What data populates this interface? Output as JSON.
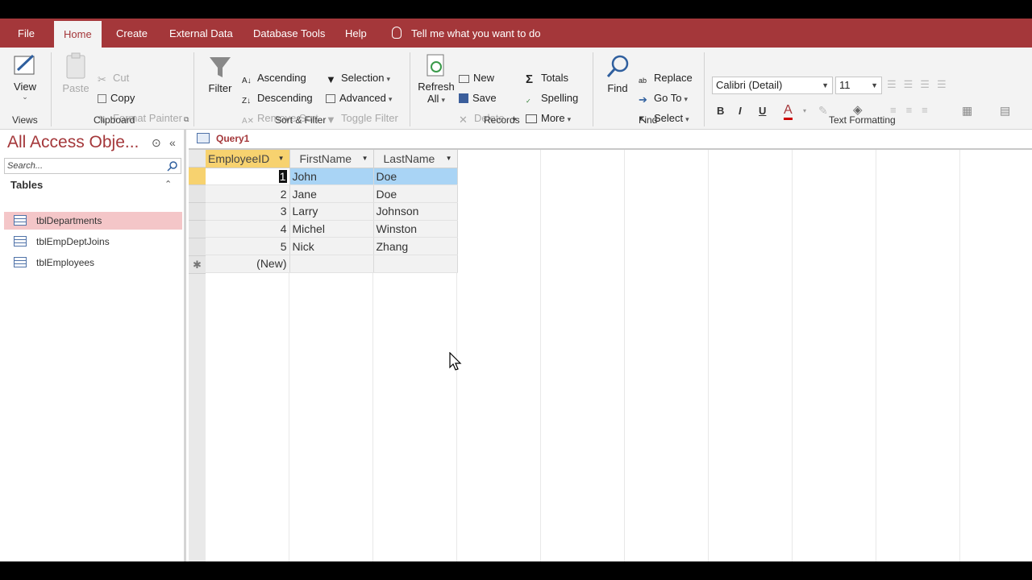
{
  "tabs": {
    "file": "File",
    "home": "Home",
    "create": "Create",
    "external": "External Data",
    "dbtools": "Database Tools",
    "help": "Help",
    "tell": "Tell me what you want to do"
  },
  "ribbon": {
    "views": {
      "view": "View",
      "label": "Views"
    },
    "clipboard": {
      "paste": "Paste",
      "cut": "Cut",
      "copy": "Copy",
      "format_painter": "Format Painter",
      "label": "Clipboard"
    },
    "sort_filter": {
      "filter": "Filter",
      "ascending": "Ascending",
      "descending": "Descending",
      "remove_sort": "Remove Sort",
      "selection": "Selection",
      "advanced": "Advanced",
      "toggle_filter": "Toggle Filter",
      "label": "Sort & Filter"
    },
    "records": {
      "refresh_1": "Refresh",
      "refresh_2": "All",
      "new": "New",
      "save": "Save",
      "delete": "Delete",
      "totals": "Totals",
      "spelling": "Spelling",
      "more": "More",
      "label": "Records"
    },
    "find": {
      "find": "Find",
      "replace": "Replace",
      "goto": "Go To",
      "select": "Select",
      "label": "Find"
    },
    "text_formatting": {
      "font": "Calibri (Detail)",
      "size": "11",
      "bold": "B",
      "italic": "I",
      "underline": "U",
      "label": "Text Formatting"
    }
  },
  "nav": {
    "title": "All Access Obje...",
    "search_placeholder": "Search...",
    "section": "Tables",
    "items": [
      "tblDepartments",
      "tblEmpDeptJoins",
      "tblEmployees"
    ]
  },
  "doc": {
    "tab": "Query1",
    "columns": [
      "EmployeeID",
      "FirstName",
      "LastName"
    ],
    "rows": [
      {
        "id": "1",
        "first": "John",
        "last": "Doe"
      },
      {
        "id": "2",
        "first": "Jane",
        "last": "Doe"
      },
      {
        "id": "3",
        "first": "Larry",
        "last": "Johnson"
      },
      {
        "id": "4",
        "first": "Michel",
        "last": "Winston"
      },
      {
        "id": "5",
        "first": "Nick",
        "last": "Zhang"
      }
    ],
    "new_row": "(New)",
    "new_marker": "✱"
  },
  "colors": {
    "accent": "#a4373a",
    "sorted_header": "#f7d26f",
    "selection": "#a9d4f5",
    "nav_selected": "#f4c6c8"
  }
}
